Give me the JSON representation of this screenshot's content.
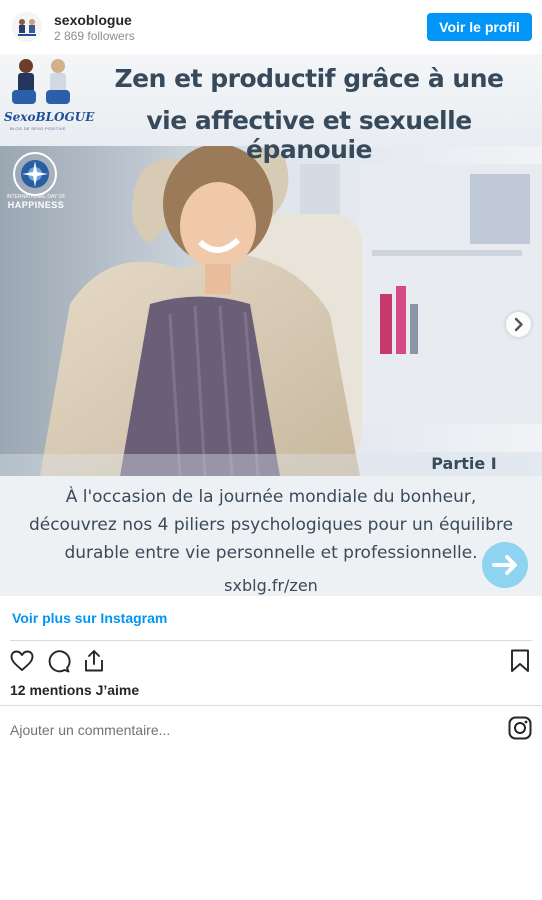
{
  "header": {
    "username": "sexoblogue",
    "followers": "2 869 followers",
    "view_profile_label": "Voir le profil"
  },
  "post": {
    "headline_line1": "Zen et productif grâce à une",
    "headline_line2": "vie affective et sexuelle épanouie",
    "logo_name": "SexoBLOGUE",
    "logo_subtitle": "BLOG DE SEXO POSITIVE",
    "emblem_text_small": "INTERNATIONAL DAY OF",
    "emblem_text_large": "HAPPINESS",
    "part_label": "Partie I",
    "caption_line1": "À l'occasion de la journée mondiale du bonheur,",
    "caption_line2": "découvrez nos 4 piliers psychologiques pour un équilibre",
    "caption_line3": "durable entre vie personnelle et professionnelle.",
    "url": "sxblg.fr/zen"
  },
  "footer": {
    "more_link": "Voir plus sur Instagram",
    "likes": "12 mentions J’aime",
    "comment_placeholder": "Ajouter un commentaire..."
  },
  "icons": {
    "like": "heart-icon",
    "comment": "comment-bubble-icon",
    "share": "share-icon",
    "save": "bookmark-icon",
    "instagram": "instagram-icon",
    "carousel": "chevron-right-icon",
    "arrow": "arrow-right-icon"
  },
  "colors": {
    "primary": "#0095f6",
    "headline": "#374a5c",
    "caption": "#3b4a59",
    "arrow_button": "#8ed3ef",
    "logo": "#1f4f94"
  }
}
